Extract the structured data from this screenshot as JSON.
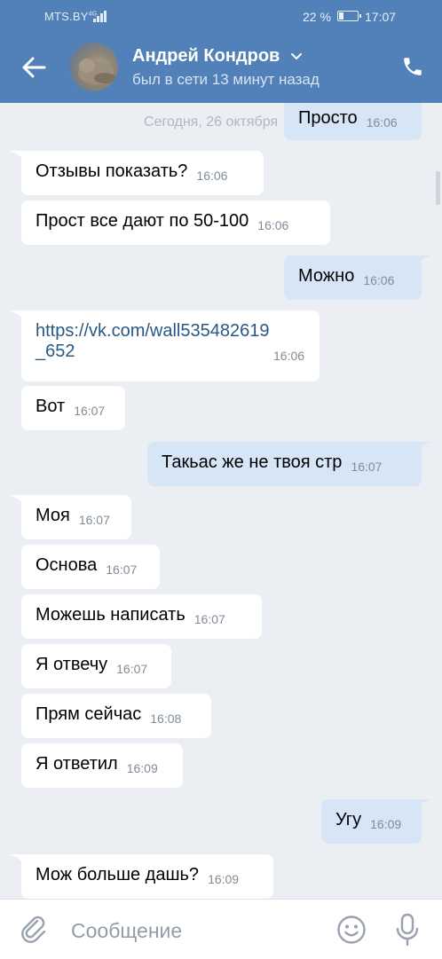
{
  "status_bar": {
    "carrier": "MTS.BY",
    "network": "4G",
    "battery": "22 %",
    "time": "17:07"
  },
  "header": {
    "name": "Андрей Кондров",
    "last_seen": "был в сети 13 минут назад"
  },
  "date_separator": "Сегодня, 26 октября",
  "messages": [
    {
      "text": "Просто",
      "time": "16:06"
    },
    {
      "text": "Отзывы показать?",
      "time": "16:06"
    },
    {
      "text": "Прост все дают по 50-100",
      "time": "16:06"
    },
    {
      "text": "Можно",
      "time": "16:06"
    },
    {
      "line1": "https://vk.com/wall535482619",
      "line2": "_652",
      "time": "16:06"
    },
    {
      "text": "Вот",
      "time": "16:07"
    },
    {
      "text": "Такьас же не твоя стр",
      "time": "16:07"
    },
    {
      "text": "Моя",
      "time": "16:07"
    },
    {
      "text": "Основа",
      "time": "16:07"
    },
    {
      "text": "Можешь написать",
      "time": "16:07"
    },
    {
      "text": "Я отвечу",
      "time": "16:07"
    },
    {
      "text": "Прям сейчас",
      "time": "16:08"
    },
    {
      "text": "Я ответил",
      "time": "16:09"
    },
    {
      "text": "Угу",
      "time": "16:09"
    },
    {
      "text": "Мож больше дашь?",
      "time": "16:09"
    }
  ],
  "composer": {
    "placeholder": "Сообщение"
  },
  "icons": [
    "back-arrow-icon",
    "chevron-down-icon",
    "phone-icon",
    "paperclip-icon",
    "smile-icon",
    "microphone-icon"
  ],
  "colors": {
    "header": "#5181b8",
    "incoming_bubble": "#ffffff",
    "outgoing_bubble": "#d6e6f6",
    "background": "#ebeef2",
    "link": "#2a5885"
  }
}
